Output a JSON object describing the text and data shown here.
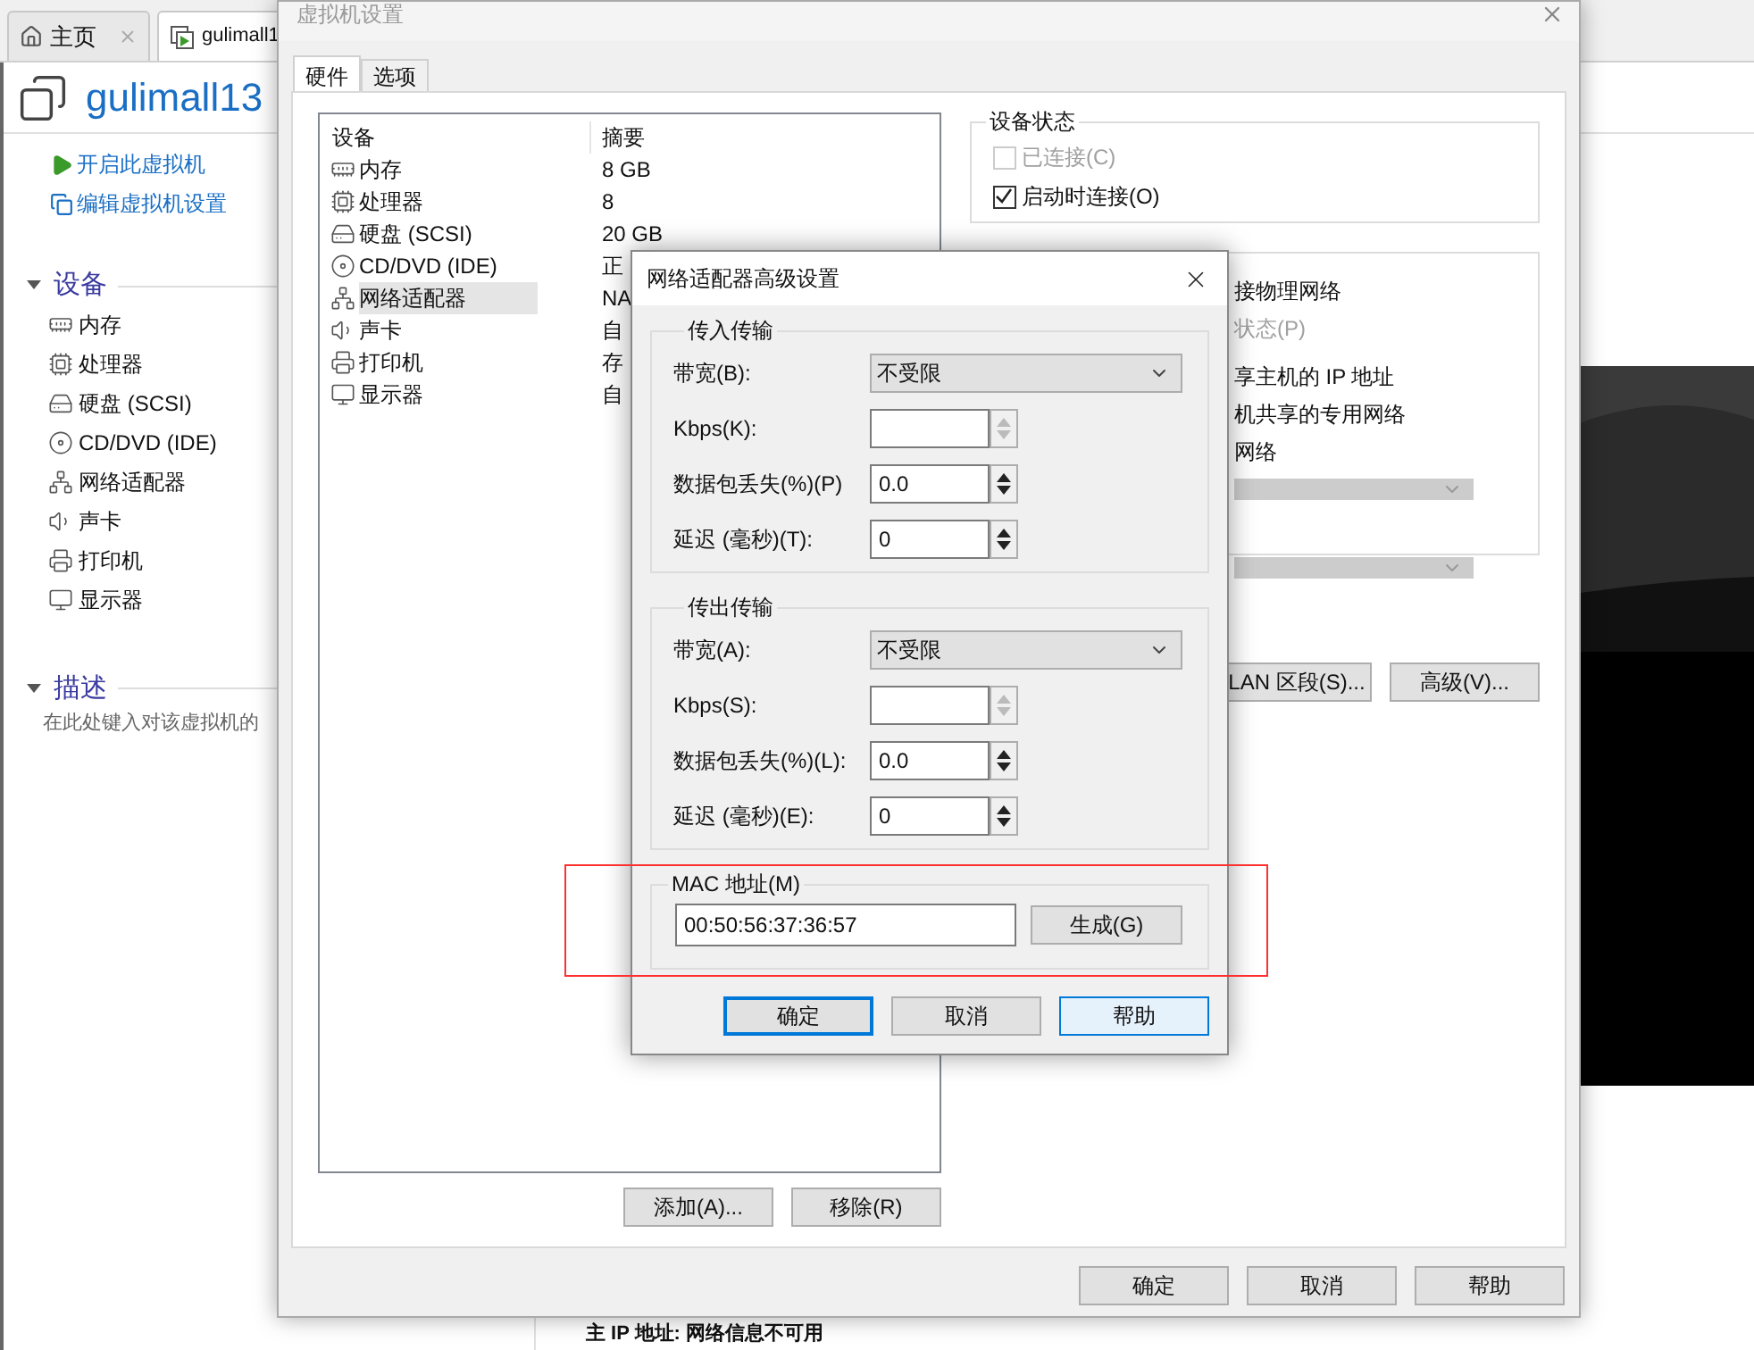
{
  "app": {
    "tabs": [
      {
        "label": "主页",
        "selected": false,
        "closable": true
      },
      {
        "label": "gulimall1",
        "selected": true,
        "closable": false
      }
    ],
    "vm_name": "gulimall13",
    "actions": [
      "开启此虚拟机",
      "编辑虚拟机设置"
    ],
    "devices_section": {
      "title": "设备",
      "expanded": true,
      "items": [
        "内存",
        "处理器",
        "硬盘 (SCSI)",
        "CD/DVD (IDE)",
        "网络适配器",
        "声卡",
        "打印机",
        "显示器"
      ]
    },
    "description_section": {
      "title": "描述",
      "expanded": true,
      "text": "在此处键入对该虚拟机的"
    },
    "ip_line": "主 IP 地址: 网络信息不可用"
  },
  "settings_dialog": {
    "title": "虚拟机设置",
    "tabs": [
      {
        "label": "硬件",
        "selected": true
      },
      {
        "label": "选项",
        "selected": false
      }
    ],
    "columns": [
      "设备",
      "摘要"
    ],
    "devices": [
      {
        "name": "内存",
        "summary": "8 GB",
        "selected": false
      },
      {
        "name": "处理器",
        "summary": "8",
        "selected": false
      },
      {
        "name": "硬盘 (SCSI)",
        "summary": "20 GB",
        "selected": false
      },
      {
        "name": "CD/DVD (IDE)",
        "summary": "正",
        "selected": false
      },
      {
        "name": "网络适配器",
        "summary": "NA",
        "selected": true
      },
      {
        "name": "声卡",
        "summary": "自",
        "selected": false
      },
      {
        "name": "打印机",
        "summary": "存",
        "selected": false
      },
      {
        "name": "显示器",
        "summary": "自",
        "selected": false
      }
    ],
    "list_buttons": [
      "添加(A)...",
      "移除(R)"
    ],
    "device_status": {
      "title": "设备状态",
      "options": [
        {
          "label": "已连接(C)",
          "checked": false,
          "disabled": true
        },
        {
          "label": "启动时连接(O)",
          "checked": true,
          "disabled": false
        }
      ]
    },
    "network_lines": [
      {
        "text": "接物理网络",
        "disabled": false
      },
      {
        "text": "状态(P)",
        "disabled": true
      },
      {
        "text": "享主机的 IP 地址",
        "disabled": false
      },
      {
        "text": "机共享的专用网络",
        "disabled": false
      },
      {
        "text": "网络",
        "disabled": false
      }
    ],
    "network_buttons": [
      "LAN 区段(S)...",
      "高级(V)..."
    ],
    "buttons": [
      "确定",
      "取消",
      "帮助"
    ]
  },
  "advanced_dialog": {
    "title": "网络适配器高级设置",
    "groups": [
      {
        "title": "传入传输",
        "fields": [
          {
            "kind": "select",
            "label": "带宽(B):",
            "value": "不受限"
          },
          {
            "kind": "spin",
            "label": "Kbps(K):",
            "disabled": true
          },
          {
            "kind": "spin",
            "label": "数据包丢失(%)(P)",
            "value": "0.0",
            "disabled": false
          },
          {
            "kind": "spin",
            "label": "延迟 (毫秒)(T):",
            "value": "0",
            "disabled": false
          }
        ]
      },
      {
        "title": "传出传输",
        "fields": [
          {
            "kind": "select",
            "label": "带宽(A):",
            "value": "不受限"
          },
          {
            "kind": "spin",
            "label": "Kbps(S):",
            "disabled": true
          },
          {
            "kind": "spin",
            "label": "数据包丢失(%)(L):",
            "value": "0.0",
            "disabled": false
          },
          {
            "kind": "spin",
            "label": "延迟 (毫秒)(E):",
            "value": "0",
            "disabled": false
          }
        ]
      }
    ],
    "mac": {
      "title": "MAC 地址(M)",
      "value": "00:50:56:37:36:57",
      "button": "生成(G)"
    },
    "buttons": [
      {
        "label": "确定",
        "default": true,
        "hovered": false
      },
      {
        "label": "取消",
        "default": false,
        "hovered": false
      },
      {
        "label": "帮助",
        "default": false,
        "hovered": true
      }
    ]
  }
}
